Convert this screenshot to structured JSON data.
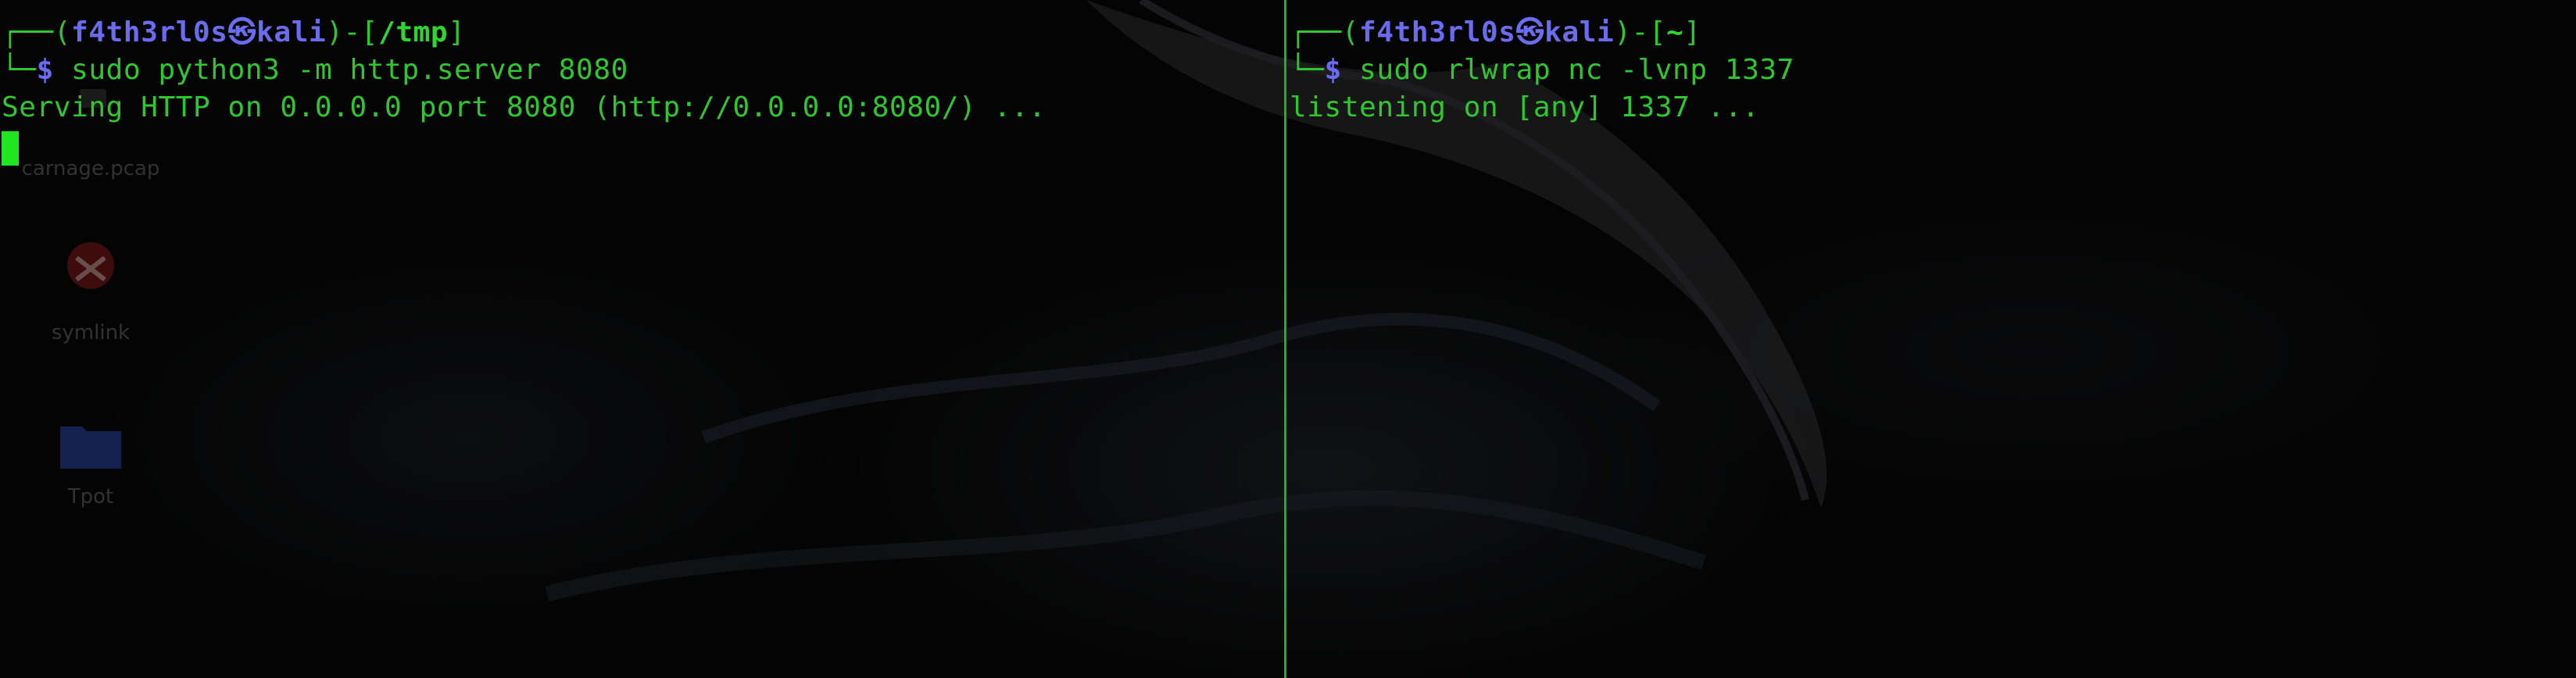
{
  "icons": {
    "pcap_file": "file-icon",
    "symlink": "kali-logo-icon",
    "folder": "folder-icon"
  },
  "desktop": {
    "items": [
      {
        "label": "carnage.pcap"
      },
      {
        "label": "symlink"
      },
      {
        "label": "Tpot"
      }
    ]
  },
  "colors": {
    "text_green": "#2ec82e",
    "prompt_blue": "#6a6cf0",
    "divider": "#19b419",
    "cursor": "#22e522"
  },
  "left_pane": {
    "corner_top": "┌──(",
    "user_host": "f4th3rl0s㉿kali",
    "mid": ")-[",
    "cwd": "/tmp",
    "end": "]",
    "corner_bottom": "└─",
    "prompt": "$",
    "command": " sudo python3 -m http.server 8080",
    "output": "Serving HTTP on 0.0.0.0 port 8080 (http://0.0.0.0:8080/) ..."
  },
  "right_pane": {
    "corner_top": "┌──(",
    "user_host": "f4th3rl0s㉿kali",
    "mid": ")-[",
    "cwd": "~",
    "end": "]",
    "corner_bottom": "└─",
    "prompt": "$",
    "command": " sudo rlwrap nc -lvnp 1337",
    "output": "listening on [any] 1337 ..."
  }
}
